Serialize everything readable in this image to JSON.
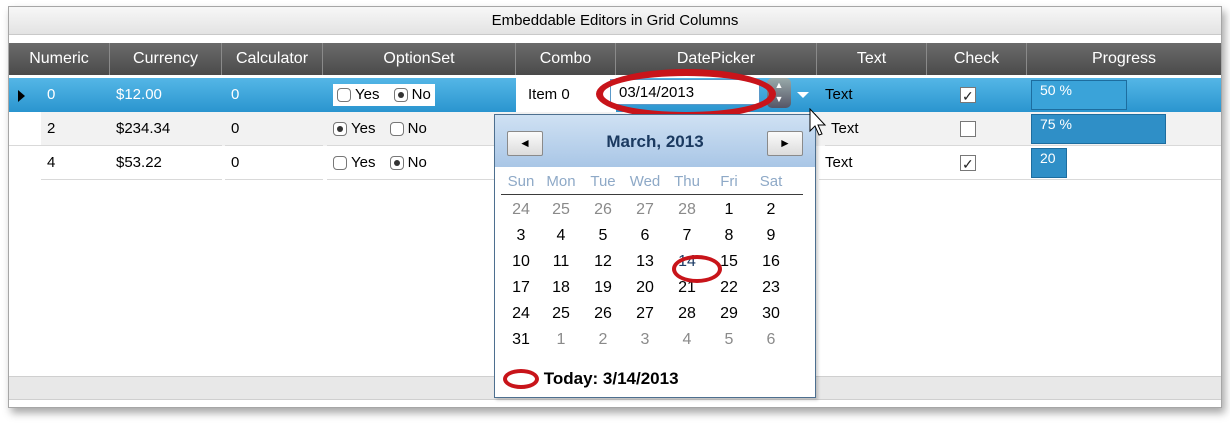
{
  "window": {
    "title": "Embeddable Editors in Grid Columns"
  },
  "columns": [
    "Numeric",
    "Currency",
    "Calculator",
    "OptionSet",
    "Combo",
    "DatePicker",
    "Text",
    "Check",
    "Progress"
  ],
  "option_labels": {
    "yes": "Yes",
    "no": "No"
  },
  "rows": [
    {
      "numeric": "0",
      "currency": "$12.00",
      "calculator": "0",
      "option": "No",
      "combo": "Item 0",
      "text": "Text",
      "check": true,
      "progress": 50,
      "progress_label": "50 %",
      "selected": true
    },
    {
      "numeric": "2",
      "currency": "$234.34",
      "calculator": "0",
      "option": "Yes",
      "combo": "",
      "text": "Text",
      "check": false,
      "progress": 75,
      "progress_label": "75 %",
      "selected": false
    },
    {
      "numeric": "4",
      "currency": "$53.22",
      "calculator": "0",
      "option": "No",
      "combo": "",
      "text": "Text",
      "check": true,
      "progress": 20,
      "progress_label": "20 %",
      "selected": false
    }
  ],
  "datepicker": {
    "value": "03/14/2013",
    "month_label": "March, 2013",
    "prev_glyph": "◄",
    "next_glyph": "►",
    "weekdays": [
      "Sun",
      "Mon",
      "Tue",
      "Wed",
      "Thu",
      "Fri",
      "Sat"
    ],
    "weeks": [
      [
        "24",
        "25",
        "26",
        "27",
        "28",
        "1",
        "2"
      ],
      [
        "3",
        "4",
        "5",
        "6",
        "7",
        "8",
        "9"
      ],
      [
        "10",
        "11",
        "12",
        "13",
        "14",
        "15",
        "16"
      ],
      [
        "17",
        "18",
        "19",
        "20",
        "21",
        "22",
        "23"
      ],
      [
        "24",
        "25",
        "26",
        "27",
        "28",
        "29",
        "30"
      ],
      [
        "31",
        "1",
        "2",
        "3",
        "4",
        "5",
        "6"
      ]
    ],
    "selected_day": "14",
    "today_label": "Today: 3/14/2013"
  },
  "colors": {
    "selection": "#2a95cf",
    "header": "#555555",
    "annotation": "#c8141a",
    "progress": "#2f8fc7"
  }
}
